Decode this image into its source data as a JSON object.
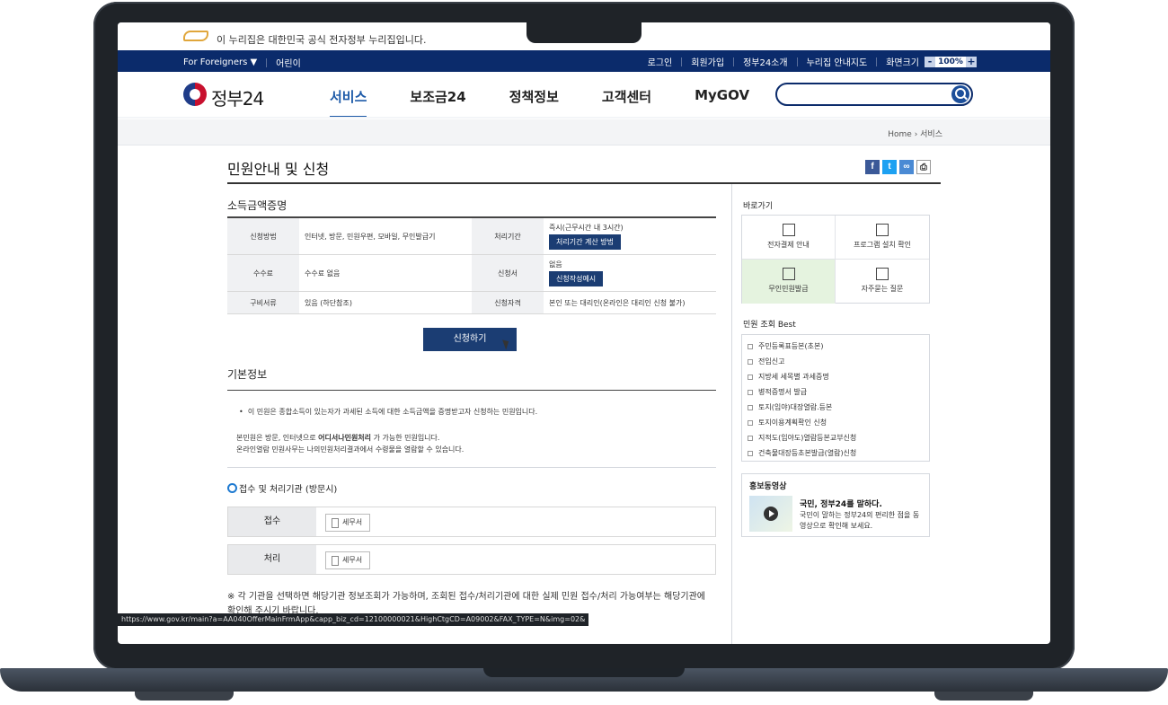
{
  "gov_banner": {
    "text": "이 누리집은 대한민국 공식 전자정부 누리집입니다."
  },
  "util_bar": {
    "left": [
      "For Foreigners ▼",
      "어린이"
    ],
    "right": [
      "로그인",
      "회원가입",
      "정부24소개",
      "누리집 안내지도",
      "화면크기"
    ],
    "zoom": {
      "minus": "-",
      "value": "100%",
      "plus": "+"
    }
  },
  "header": {
    "logo_text": "정부24",
    "nav": [
      "서비스",
      "보조금24",
      "정책정보",
      "고객센터",
      "MyGOV"
    ],
    "search_placeholder": ""
  },
  "breadcrumb": "Home › 서비스",
  "page_title": "민원안내 및 신청",
  "share": [
    "f",
    "t",
    "∞",
    "⎙"
  ],
  "summary": {
    "title": "소득금액증명",
    "rows": [
      {
        "h1": "신청방법",
        "v1": "인터넷, 방문, 민원우편, 모바일, 무인발급기",
        "h2": "처리기간",
        "v2": "즉시(근무시간 내 3시간)",
        "btn": "처리기간 계산 방법"
      },
      {
        "h1": "수수료",
        "v1": "수수료 없음",
        "h2": "신청서",
        "v2": "없음",
        "btn": "신청작성예시"
      },
      {
        "h1": "구비서류",
        "v1": "있음 (하단참조)",
        "h2": "신청자격",
        "v2": "본인 또는 대리인(온라인은 대리인 신청 불가)",
        "btn": ""
      }
    ],
    "apply_button": "신청하기"
  },
  "basic": {
    "title": "기본정보",
    "bullet": "이 민원은 종합소득이 있는자가 과세된 소득에 대한 소득금액을 증명받고자 신청하는 민원입니다.",
    "note1_pre": "본민원은 방문, 인터넷으로 ",
    "note1_bold": "어디서나민원처리",
    "note1_post": " 가 가능한 민원입니다.",
    "note2": "온라인열람 민원사무는 나의민원처리결과에서 수령물을 열람할 수 있습니다."
  },
  "org": {
    "title": "접수 및 처리기관 (방문시)",
    "rows": [
      {
        "head": "접수",
        "chip": "세무서"
      },
      {
        "head": "처리",
        "chip": "세무서"
      }
    ]
  },
  "notice": "※ 각 기관을 선택하면 해당기관 정보조회가 가능하며, 조회된 접수/처리기관에 대한 실제 민원 접수/처리 가능여부는 해당기관에 확인해 주시기 바랍니다.",
  "status_url": "https://www.gov.kr/main?a=AA040OfferMainFrmApp&capp_biz_cd=12100000021&HighCtgCD=A09002&FAX_TYPE=N&img=02&",
  "sidebar": {
    "quick_title": "바로가기",
    "quick": [
      "전자결제 안내",
      "프로그램 설치 확인",
      "무인민원발급",
      "자주묻는 질문"
    ],
    "best_title": "민원 조회 Best",
    "best": [
      "주민등록표등본(초본)",
      "전입신고",
      "지방세 세목별 과세증명",
      "병적증명서 발급",
      "토지(임야)대장열람.등본",
      "토지이용계획확인 신청",
      "지적도(임야도)열람등본교부신청",
      "건축물대장등초본발급(열람)신청"
    ],
    "promo_title": "홍보동영상",
    "promo_head": "국민, 정부24를 말하다.",
    "promo_desc": "국민이 말하는 정부24의 편리한 점을 동영상으로 확인해 보세요."
  }
}
